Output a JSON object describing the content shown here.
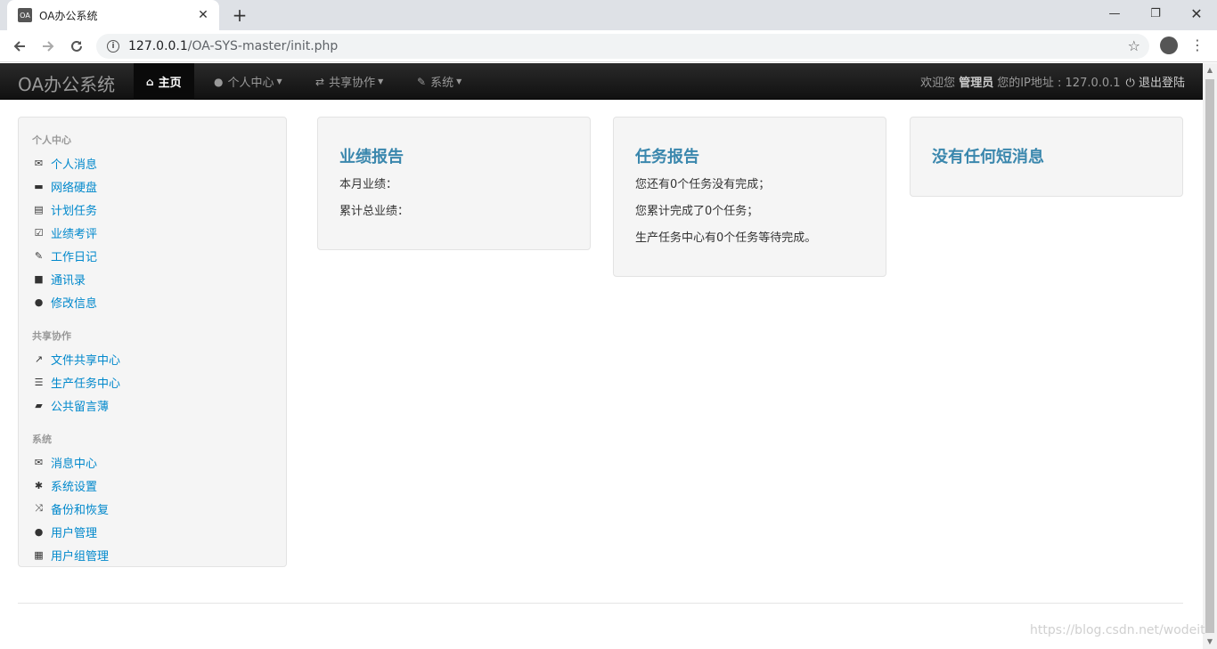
{
  "browser": {
    "tab_title": "OA办公系统",
    "favicon_text": "OA",
    "url_host": "127.0.0.1",
    "url_path": "/OA-SYS-master/init.php"
  },
  "navbar": {
    "brand": "OA办公系统",
    "items": [
      {
        "label": "主页",
        "icon": "home-icon"
      },
      {
        "label": "个人中心",
        "icon": "user-icon"
      },
      {
        "label": "共享协作",
        "icon": "retweet-icon"
      },
      {
        "label": "系统",
        "icon": "wrench-icon"
      }
    ],
    "welcome_prefix": "欢迎您",
    "username": "管理员",
    "ip_label": "您的IP地址 : 127.0.0.1",
    "logout": "退出登陆"
  },
  "sidebar": {
    "sections": [
      {
        "header": "个人中心",
        "items": [
          {
            "label": "个人消息",
            "icon": "envelope-icon"
          },
          {
            "label": "网络硬盘",
            "icon": "hdd-icon"
          },
          {
            "label": "计划任务",
            "icon": "list-alt-icon"
          },
          {
            "label": "业绩考评",
            "icon": "check-icon"
          },
          {
            "label": "工作日记",
            "icon": "pencil-icon"
          },
          {
            "label": "通讯录",
            "icon": "book-icon"
          },
          {
            "label": "修改信息",
            "icon": "user-icon"
          }
        ]
      },
      {
        "header": "共享协作",
        "items": [
          {
            "label": "文件共享中心",
            "icon": "share-icon"
          },
          {
            "label": "生产任务中心",
            "icon": "tasks-icon"
          },
          {
            "label": "公共留言薄",
            "icon": "comment-icon"
          }
        ]
      },
      {
        "header": "系统",
        "items": [
          {
            "label": "消息中心",
            "icon": "envelope-icon"
          },
          {
            "label": "系统设置",
            "icon": "asterisk-icon"
          },
          {
            "label": "备份和恢复",
            "icon": "random-icon"
          },
          {
            "label": "用户管理",
            "icon": "user-icon"
          },
          {
            "label": "用户组管理",
            "icon": "th-large-icon"
          }
        ]
      }
    ]
  },
  "cards": {
    "performance": {
      "title": "业绩报告",
      "lines": [
        "本月业绩：",
        "累计总业绩："
      ]
    },
    "tasks": {
      "title": "任务报告",
      "lines": [
        "您还有0个任务没有完成；",
        "您累计完成了0个任务；",
        "生产任务中心有0个任务等待完成。"
      ]
    },
    "messages": {
      "title": "没有任何短消息"
    }
  },
  "watermark": "https://blog.csdn.net/wodeit"
}
